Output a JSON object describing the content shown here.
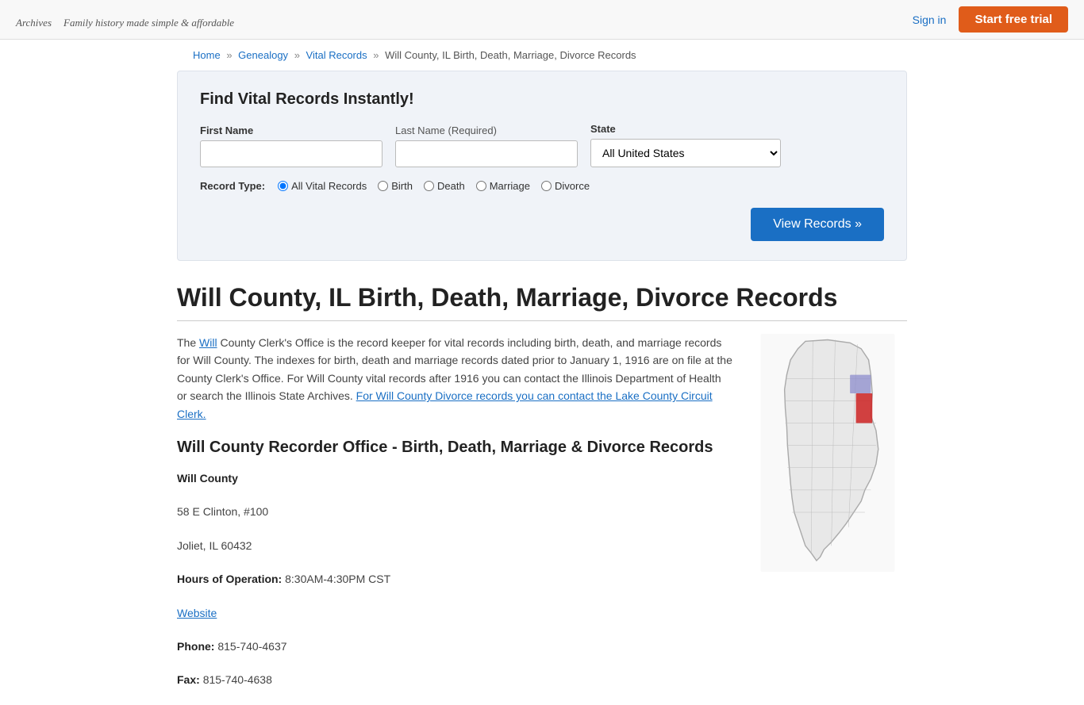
{
  "header": {
    "logo_text": "Archives",
    "tagline": "Family history made simple & affordable",
    "sign_in_label": "Sign in",
    "start_trial_label": "Start free trial"
  },
  "breadcrumb": {
    "home": "Home",
    "genealogy": "Genealogy",
    "vital_records": "Vital Records",
    "current": "Will County, IL Birth, Death, Marriage, Divorce Records"
  },
  "search": {
    "title": "Find Vital Records Instantly!",
    "first_name_label": "First Name",
    "last_name_label": "Last Name",
    "last_name_required": "(Required)",
    "state_label": "State",
    "state_default": "All United States",
    "record_type_label": "Record Type:",
    "record_types": [
      {
        "id": "all",
        "label": "All Vital Records",
        "checked": true
      },
      {
        "id": "birth",
        "label": "Birth",
        "checked": false
      },
      {
        "id": "death",
        "label": "Death",
        "checked": false
      },
      {
        "id": "marriage",
        "label": "Marriage",
        "checked": false
      },
      {
        "id": "divorce",
        "label": "Divorce",
        "checked": false
      }
    ],
    "view_records_btn": "View Records »"
  },
  "page": {
    "title": "Will County, IL Birth, Death, Marriage, Divorce Records",
    "description": "The Will County Clerk's Office is the record keeper for vital records including birth, death, and marriage records for Will County. The indexes for birth, death and marriage records dated prior to January 1, 1916 are on file at the County Clerk's Office. For Will County vital records after 1916 you can contact the Illinois Department of Health or search the Illinois State Archives. For Will County Divorce records you can contact the Lake County Circuit Clerk.",
    "office_title": "Will County Recorder Office - Birth, Death, Marriage & Divorce Records",
    "office_name": "Will County",
    "address1": "58 E Clinton, #100",
    "address2": "Joliet, IL 60432",
    "hours_label": "Hours of Operation:",
    "hours_value": "8:30AM-4:30PM CST",
    "website_label": "Website",
    "phone_label": "Phone:",
    "phone_value": "815-740-4637",
    "fax_label": "Fax:",
    "fax_value": "815-740-4638"
  },
  "colors": {
    "accent_blue": "#1a6fc4",
    "accent_orange": "#e05c1a",
    "map_highlight": "#cc2222",
    "map_highlight2": "#8888cc"
  }
}
